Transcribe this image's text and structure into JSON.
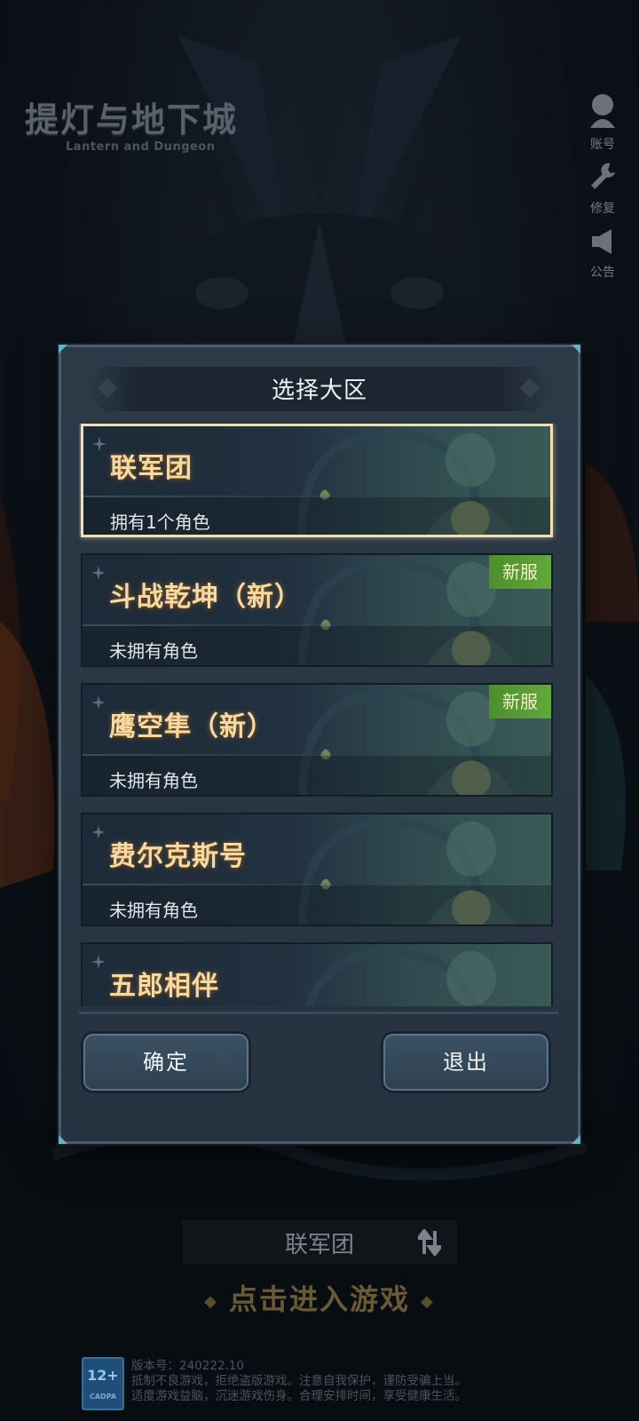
{
  "game": {
    "title": "提灯与地下城",
    "subtitle": "Lantern and Dungeon"
  },
  "side_buttons": [
    {
      "label": "账号",
      "icon": "account-icon"
    },
    {
      "label": "修复",
      "icon": "wrench-icon"
    },
    {
      "label": "公告",
      "icon": "megaphone-icon"
    }
  ],
  "modal": {
    "title": "选择大区",
    "servers": [
      {
        "name": "联军团",
        "status": "拥有1个角色",
        "badge": "",
        "selected": true
      },
      {
        "name": "斗战乾坤（新）",
        "status": "未拥有角色",
        "badge": "新服",
        "selected": false
      },
      {
        "name": "鹰空隼（新）",
        "status": "未拥有角色",
        "badge": "新服",
        "selected": false
      },
      {
        "name": "费尔克斯号",
        "status": "未拥有角色",
        "badge": "",
        "selected": false
      },
      {
        "name": "五郎相伴",
        "status": "",
        "badge": "",
        "selected": false
      }
    ],
    "confirm_label": "确定",
    "exit_label": "退出"
  },
  "bottom": {
    "current_server": "联军团",
    "enter_game": "点击进入游戏",
    "age_rating": "12+",
    "age_rating_sub": "CADPA",
    "version": "版本号：240222.10",
    "notice_line1": "抵制不良游戏，拒绝盗版游戏。注意自我保护，谨防受骗上当。",
    "notice_line2": "适度游戏益脑，沉迷游戏伤身。合理安排时间，享受健康生活。"
  },
  "colors": {
    "accent_gold": "#f7d9a3",
    "new_badge": "#5a9e34",
    "selected_border": "#f2dfae",
    "modal_bg": "#2a3744"
  }
}
